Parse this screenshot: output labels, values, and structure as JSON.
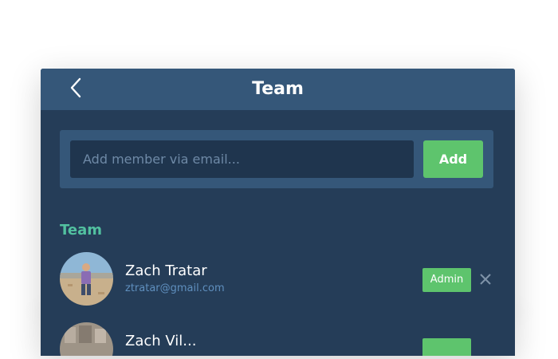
{
  "header": {
    "title": "Team",
    "back_icon": "chevron-left-icon"
  },
  "add_member": {
    "placeholder": "Add member via email...",
    "button_label": "Add"
  },
  "section": {
    "label": "Team"
  },
  "members": [
    {
      "name": "Zach Tratar",
      "email": "ztratar@gmail.com",
      "role": "Admin"
    },
    {
      "name": "Zach Vil...",
      "email": "",
      "role": ""
    }
  ],
  "colors": {
    "panel_bg": "#253d58",
    "header_bg": "#355779",
    "input_bg": "#1f354e",
    "accent_green": "#5ec46d",
    "section_label": "#52c1a0",
    "email_text": "#5f8fbe"
  }
}
